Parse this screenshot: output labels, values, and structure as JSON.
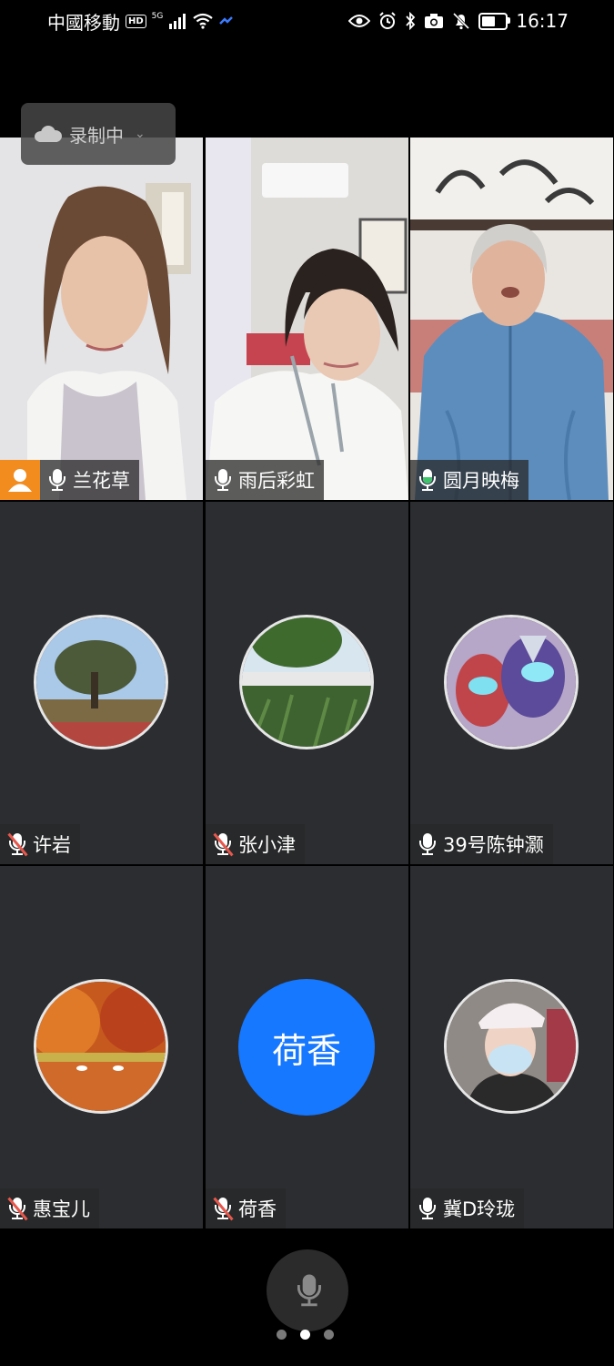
{
  "status_bar": {
    "carrier": "中國移動",
    "hd": "HD",
    "network": "5G",
    "time": "16:17"
  },
  "recording": {
    "label": "录制中"
  },
  "participants": [
    {
      "name": "兰花草",
      "type": "video",
      "mic": "on",
      "host": true
    },
    {
      "name": "雨后彩虹",
      "type": "video",
      "mic": "on"
    },
    {
      "name": "圆月映梅",
      "type": "video",
      "mic": "speaking",
      "active": true
    },
    {
      "name": "许岩",
      "type": "avatar",
      "mic": "muted"
    },
    {
      "name": "张小津",
      "type": "avatar",
      "mic": "muted"
    },
    {
      "name": "39号陈钟灏",
      "type": "avatar",
      "mic": "on"
    },
    {
      "name": "惠宝儿",
      "type": "avatar",
      "mic": "muted"
    },
    {
      "name": "荷香",
      "type": "text-avatar",
      "mic": "muted",
      "avatar_text": "荷香"
    },
    {
      "name": "冀D玲珑",
      "type": "avatar",
      "mic": "on"
    }
  ],
  "pager": {
    "pages": 3,
    "current": 2
  },
  "colors": {
    "accent_blue": "#1677ff",
    "speaking_green": "#3fc36b",
    "muted_red": "#e6584d",
    "host_orange": "#f28c1e"
  }
}
